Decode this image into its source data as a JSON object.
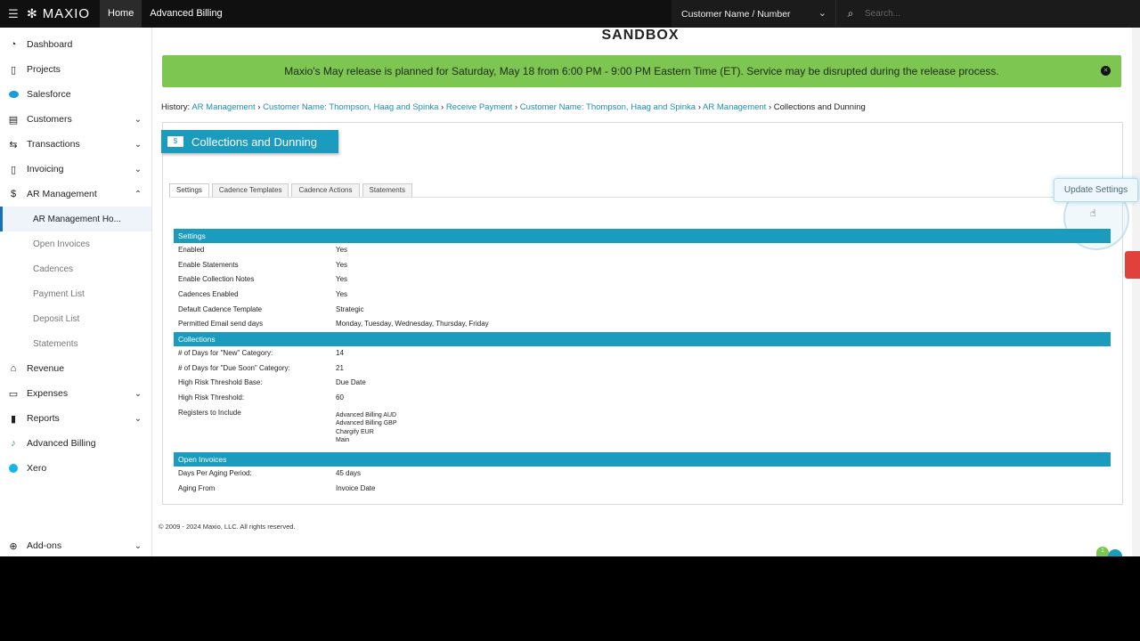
{
  "topbar": {
    "brand": "MAXIO",
    "nav": [
      "Home",
      "Advanced Billing"
    ],
    "customer_select": "Customer Name / Number",
    "search_placeholder": "Search..."
  },
  "sidebar": {
    "items": [
      {
        "label": "Dashboard",
        "icon": "dashboard-icon"
      },
      {
        "label": "Projects",
        "icon": "clipboard-icon"
      },
      {
        "label": "Salesforce",
        "icon": "salesforce-icon"
      },
      {
        "label": "Customers",
        "icon": "building-icon"
      },
      {
        "label": "Transactions",
        "icon": "transfer-icon"
      },
      {
        "label": "Invoicing",
        "icon": "document-icon"
      },
      {
        "label": "AR Management",
        "icon": "dollar-icon"
      },
      {
        "label": "Revenue",
        "icon": "bank-icon"
      },
      {
        "label": "Expenses",
        "icon": "card-icon"
      },
      {
        "label": "Reports",
        "icon": "bar-chart-icon"
      },
      {
        "label": "Advanced Billing",
        "icon": "advanced-billing-icon"
      },
      {
        "label": "Xero",
        "icon": "xero-icon"
      },
      {
        "label": "Add-ons",
        "icon": "plus-circle-icon"
      }
    ],
    "ar_subitems": [
      "AR Management Ho...",
      "Open Invoices",
      "Cadences",
      "Payment List",
      "Deposit List",
      "Statements"
    ]
  },
  "main": {
    "env_label": "SANDBOX",
    "banner": "Maxio's May release is planned for Saturday, May 18 from 6:00 PM - 9:00 PM Eastern Time (ET). Service may be disrupted during the release process.",
    "history": {
      "prefix": "History:",
      "links": [
        "AR Management",
        "Customer Name: Thompson, Haag and Spinka",
        "Receive Payment",
        "Customer Name: Thompson, Haag and Spinka",
        "AR Management"
      ],
      "current": "Collections and Dunning",
      "separator": "›"
    },
    "page_title": "Collections and Dunning",
    "tabs": [
      "Settings",
      "Cadence Templates",
      "Cadence Actions",
      "Statements"
    ],
    "update_button": "Update Settings",
    "sections": {
      "settings": {
        "title": "Settings",
        "rows": [
          {
            "k": "Enabled",
            "v": "Yes"
          },
          {
            "k": "Enable Statements",
            "v": "Yes"
          },
          {
            "k": "Enable Collection Notes",
            "v": "Yes"
          },
          {
            "k": "Cadences Enabled",
            "v": "Yes"
          },
          {
            "k": "Default Cadence Template",
            "v": "Strategic"
          },
          {
            "k": "Permitted Email send days",
            "v": "Monday, Tuesday, Wednesday, Thursday, Friday"
          }
        ]
      },
      "collections": {
        "title": "Collections",
        "rows": [
          {
            "k": "# of Days for \"New\" Category:",
            "v": "14"
          },
          {
            "k": "# of Days for \"Due Soon\" Category:",
            "v": "21"
          },
          {
            "k": "High Risk Threshold Base:",
            "v": "Due Date"
          },
          {
            "k": "High Risk Threshold:",
            "v": "60"
          },
          {
            "k": "Registers to Include",
            "v": ""
          }
        ],
        "registers": [
          "Advanced Billing AUD",
          "Advanced Billing GBP",
          "Chargify EUR",
          "Main"
        ]
      },
      "open_invoices": {
        "title": "Open Invoices",
        "rows": [
          {
            "k": "Days Per Aging Period:",
            "v": "45 days"
          },
          {
            "k": "Aging From",
            "v": "Invoice Date"
          }
        ]
      }
    },
    "footer": "© 2009 - 2024 Maxio, LLC. All rights reserved.",
    "badge_count": "1"
  }
}
